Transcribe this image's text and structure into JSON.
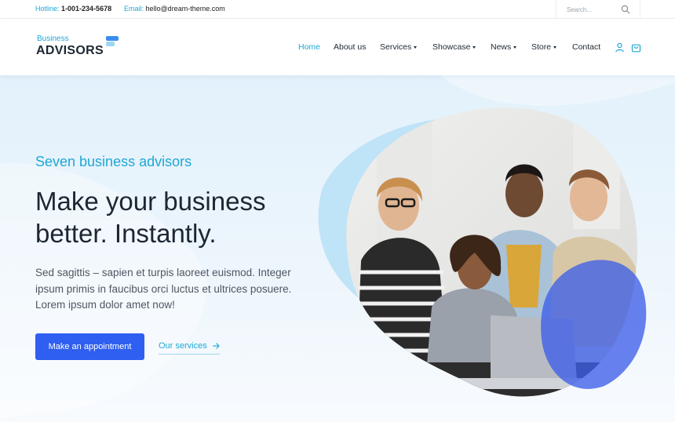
{
  "topbar": {
    "hotline_label": "Hotline:",
    "hotline_value": "1-001-234-5678",
    "email_label": "Email:",
    "email_value": "hello@dream-theme.com",
    "search_placeholder": "Search..."
  },
  "logo": {
    "line1": "Business",
    "line2": "ADVISORS"
  },
  "nav": {
    "items": [
      {
        "label": "Home",
        "active": true
      },
      {
        "label": "About us"
      },
      {
        "label": "Services",
        "dropdown": true
      },
      {
        "label": "Showcase",
        "dropdown": true
      },
      {
        "label": "News",
        "dropdown": true
      },
      {
        "label": "Store",
        "dropdown": true
      },
      {
        "label": "Contact"
      }
    ],
    "icons": [
      "user-icon",
      "cart-icon"
    ]
  },
  "hero": {
    "eyebrow": "Seven business advisors",
    "headline_line1": "Make your business",
    "headline_line2": "better. Instantly.",
    "lead_line1": "Sed sagittis – sapien et turpis laoreet euismod. Integer",
    "lead_line2": "ipsum primis in faucibus orci luctus et ultrices posuere.",
    "lead_line3": "Lorem ipsum dolor amet now!",
    "primary_button": "Make an appointment",
    "secondary_link": "Our services",
    "image": "team-meeting-photo"
  },
  "colors": {
    "accent": "#1fa7d4",
    "primary_button": "#2f5ff0",
    "text_dark": "#1d2733",
    "hero_bg": "#e2f1fb"
  }
}
